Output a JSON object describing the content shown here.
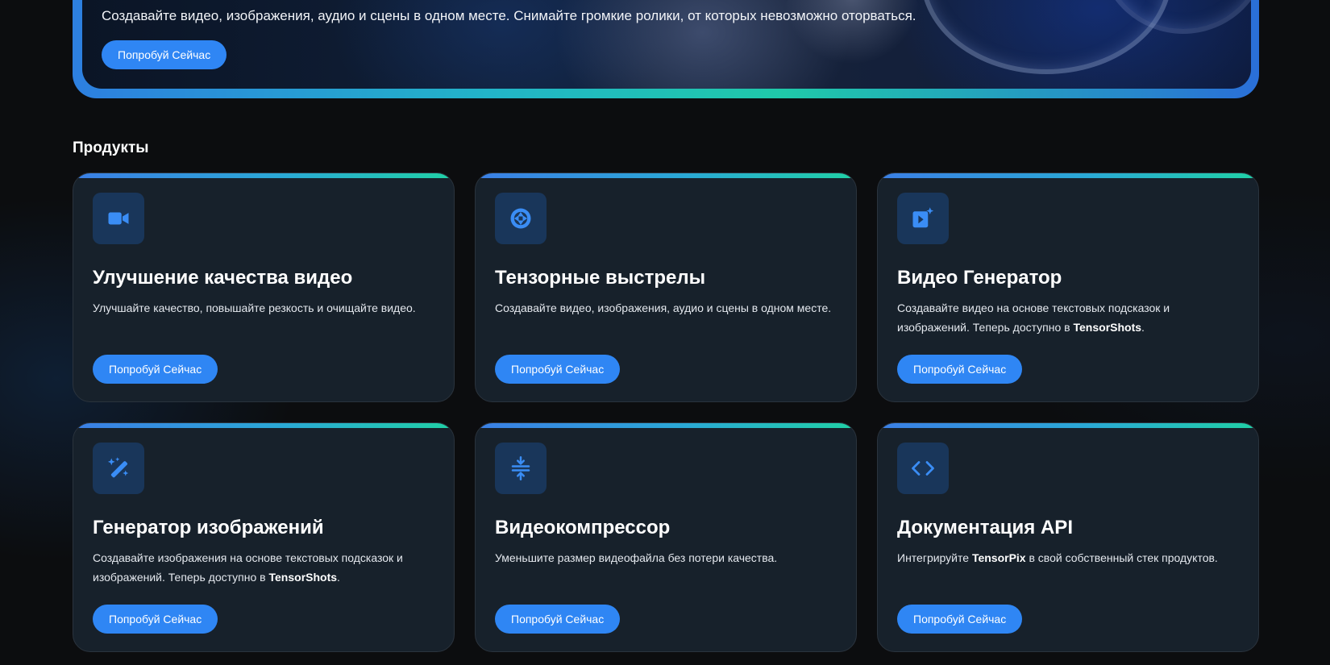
{
  "hero": {
    "description": "Создавайте видео, изображения, аудио и сцены в одном месте. Снимайте громкие ролики, от которых невозможно оторваться.",
    "button_label": "Попробуй Сейчас"
  },
  "products": {
    "title": "Продукты",
    "items": [
      {
        "icon": "video-camera-icon",
        "title": "Улучшение качества видео",
        "desc_before": "Улучшайте качество, повышайте резкость и очищайте видео.",
        "desc_brand": "",
        "desc_after": "",
        "button_label": "Попробуй Сейчас"
      },
      {
        "icon": "shutter-icon",
        "title": "Тензорные выстрелы",
        "desc_before": "Создавайте видео, изображения, аудио и сцены в одном месте.",
        "desc_brand": "",
        "desc_after": "",
        "button_label": "Попробуй Сейчас"
      },
      {
        "icon": "video-sparkle-icon",
        "title": "Видео Генератор",
        "desc_before": "Создавайте видео на основе текстовых подсказок и изображений. Теперь доступно в ",
        "desc_brand": "TensorShots",
        "desc_after": ".",
        "button_label": "Попробуй Сейчас"
      },
      {
        "icon": "magic-wand-icon",
        "title": "Генератор изображений",
        "desc_before": "Создавайте изображения на основе текстовых подсказок и изображений. Теперь доступно в ",
        "desc_brand": "TensorShots",
        "desc_after": ".",
        "button_label": "Попробуй Сейчас"
      },
      {
        "icon": "compress-icon",
        "title": "Видеокомпрессор",
        "desc_before": "Уменьшите размер видеофайла без потери качества.",
        "desc_brand": "",
        "desc_after": "",
        "button_label": "Попробуй Сейчас"
      },
      {
        "icon": "code-icon",
        "title": "Документация API",
        "desc_before": "Интегрируйте ",
        "desc_brand": "TensorPix",
        "desc_after": " в свой собственный стек продуктов.",
        "button_label": "Попробуй Сейчас"
      }
    ]
  },
  "colors": {
    "accent": "#2f86f4",
    "card_bg": "#17212b",
    "icon_bg": "#19365a",
    "page_bg": "#0c0d0f",
    "gradient_start": "#3b7fe6",
    "gradient_end": "#20d1a6"
  }
}
